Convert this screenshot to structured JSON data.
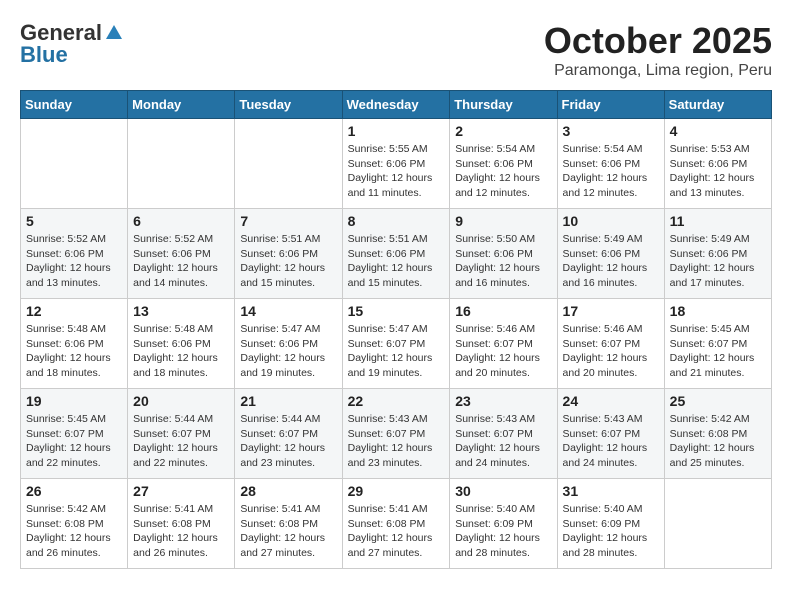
{
  "header": {
    "logo_general": "General",
    "logo_blue": "Blue",
    "month_title": "October 2025",
    "location": "Paramonga, Lima region, Peru"
  },
  "days_of_week": [
    "Sunday",
    "Monday",
    "Tuesday",
    "Wednesday",
    "Thursday",
    "Friday",
    "Saturday"
  ],
  "weeks": [
    [
      {
        "day": "",
        "info": ""
      },
      {
        "day": "",
        "info": ""
      },
      {
        "day": "",
        "info": ""
      },
      {
        "day": "1",
        "info": "Sunrise: 5:55 AM\nSunset: 6:06 PM\nDaylight: 12 hours and 11 minutes."
      },
      {
        "day": "2",
        "info": "Sunrise: 5:54 AM\nSunset: 6:06 PM\nDaylight: 12 hours and 12 minutes."
      },
      {
        "day": "3",
        "info": "Sunrise: 5:54 AM\nSunset: 6:06 PM\nDaylight: 12 hours and 12 minutes."
      },
      {
        "day": "4",
        "info": "Sunrise: 5:53 AM\nSunset: 6:06 PM\nDaylight: 12 hours and 13 minutes."
      }
    ],
    [
      {
        "day": "5",
        "info": "Sunrise: 5:52 AM\nSunset: 6:06 PM\nDaylight: 12 hours and 13 minutes."
      },
      {
        "day": "6",
        "info": "Sunrise: 5:52 AM\nSunset: 6:06 PM\nDaylight: 12 hours and 14 minutes."
      },
      {
        "day": "7",
        "info": "Sunrise: 5:51 AM\nSunset: 6:06 PM\nDaylight: 12 hours and 15 minutes."
      },
      {
        "day": "8",
        "info": "Sunrise: 5:51 AM\nSunset: 6:06 PM\nDaylight: 12 hours and 15 minutes."
      },
      {
        "day": "9",
        "info": "Sunrise: 5:50 AM\nSunset: 6:06 PM\nDaylight: 12 hours and 16 minutes."
      },
      {
        "day": "10",
        "info": "Sunrise: 5:49 AM\nSunset: 6:06 PM\nDaylight: 12 hours and 16 minutes."
      },
      {
        "day": "11",
        "info": "Sunrise: 5:49 AM\nSunset: 6:06 PM\nDaylight: 12 hours and 17 minutes."
      }
    ],
    [
      {
        "day": "12",
        "info": "Sunrise: 5:48 AM\nSunset: 6:06 PM\nDaylight: 12 hours and 18 minutes."
      },
      {
        "day": "13",
        "info": "Sunrise: 5:48 AM\nSunset: 6:06 PM\nDaylight: 12 hours and 18 minutes."
      },
      {
        "day": "14",
        "info": "Sunrise: 5:47 AM\nSunset: 6:06 PM\nDaylight: 12 hours and 19 minutes."
      },
      {
        "day": "15",
        "info": "Sunrise: 5:47 AM\nSunset: 6:07 PM\nDaylight: 12 hours and 19 minutes."
      },
      {
        "day": "16",
        "info": "Sunrise: 5:46 AM\nSunset: 6:07 PM\nDaylight: 12 hours and 20 minutes."
      },
      {
        "day": "17",
        "info": "Sunrise: 5:46 AM\nSunset: 6:07 PM\nDaylight: 12 hours and 20 minutes."
      },
      {
        "day": "18",
        "info": "Sunrise: 5:45 AM\nSunset: 6:07 PM\nDaylight: 12 hours and 21 minutes."
      }
    ],
    [
      {
        "day": "19",
        "info": "Sunrise: 5:45 AM\nSunset: 6:07 PM\nDaylight: 12 hours and 22 minutes."
      },
      {
        "day": "20",
        "info": "Sunrise: 5:44 AM\nSunset: 6:07 PM\nDaylight: 12 hours and 22 minutes."
      },
      {
        "day": "21",
        "info": "Sunrise: 5:44 AM\nSunset: 6:07 PM\nDaylight: 12 hours and 23 minutes."
      },
      {
        "day": "22",
        "info": "Sunrise: 5:43 AM\nSunset: 6:07 PM\nDaylight: 12 hours and 23 minutes."
      },
      {
        "day": "23",
        "info": "Sunrise: 5:43 AM\nSunset: 6:07 PM\nDaylight: 12 hours and 24 minutes."
      },
      {
        "day": "24",
        "info": "Sunrise: 5:43 AM\nSunset: 6:07 PM\nDaylight: 12 hours and 24 minutes."
      },
      {
        "day": "25",
        "info": "Sunrise: 5:42 AM\nSunset: 6:08 PM\nDaylight: 12 hours and 25 minutes."
      }
    ],
    [
      {
        "day": "26",
        "info": "Sunrise: 5:42 AM\nSunset: 6:08 PM\nDaylight: 12 hours and 26 minutes."
      },
      {
        "day": "27",
        "info": "Sunrise: 5:41 AM\nSunset: 6:08 PM\nDaylight: 12 hours and 26 minutes."
      },
      {
        "day": "28",
        "info": "Sunrise: 5:41 AM\nSunset: 6:08 PM\nDaylight: 12 hours and 27 minutes."
      },
      {
        "day": "29",
        "info": "Sunrise: 5:41 AM\nSunset: 6:08 PM\nDaylight: 12 hours and 27 minutes."
      },
      {
        "day": "30",
        "info": "Sunrise: 5:40 AM\nSunset: 6:09 PM\nDaylight: 12 hours and 28 minutes."
      },
      {
        "day": "31",
        "info": "Sunrise: 5:40 AM\nSunset: 6:09 PM\nDaylight: 12 hours and 28 minutes."
      },
      {
        "day": "",
        "info": ""
      }
    ]
  ]
}
